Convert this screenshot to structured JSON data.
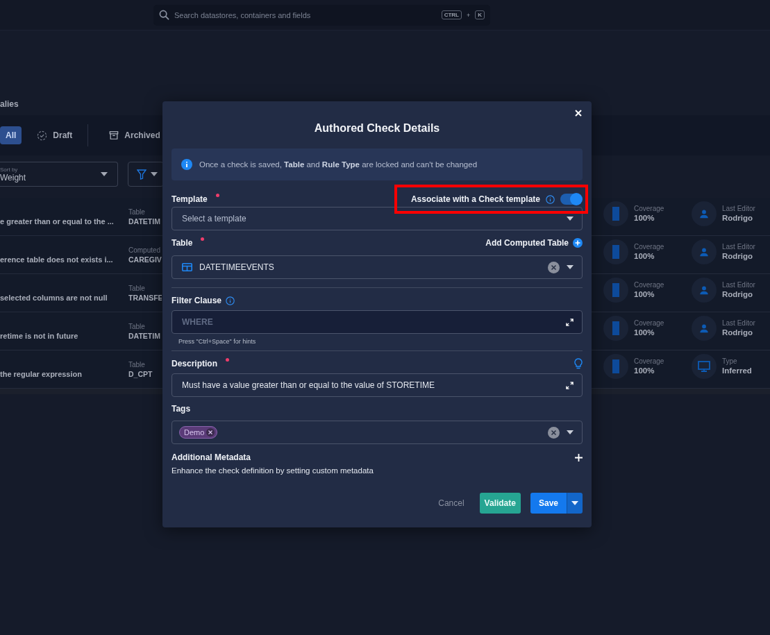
{
  "search": {
    "placeholder": "Search datastores, containers and fields",
    "keys": [
      "CTRL",
      "+",
      "K"
    ]
  },
  "page_heading": "alies",
  "status_tabs": [
    {
      "label": "All",
      "selected": true,
      "kind": "plain"
    },
    {
      "label": "Draft",
      "selected": false,
      "kind": "draft"
    },
    {
      "label": "Archived",
      "selected": false,
      "kind": "archived"
    }
  ],
  "sort": {
    "label": "Sort by",
    "value": "Weight"
  },
  "rows": [
    {
      "description": "e greater than or equal to the ...",
      "table_label": "Table",
      "table": "DATETIM",
      "coverage_label": "Coverage",
      "coverage": "100%",
      "kind": "editor",
      "meta_label": "Last Editor",
      "meta_value": "Rodrigo"
    },
    {
      "description": "erence table does not exists i...",
      "table_label": "Computed",
      "table": "CAREGIV",
      "coverage_label": "Coverage",
      "coverage": "100%",
      "kind": "editor",
      "meta_label": "Last Editor",
      "meta_value": "Rodrigo"
    },
    {
      "description": "selected columns are not null",
      "table_label": "Table",
      "table": "TRANSFE",
      "coverage_label": "Coverage",
      "coverage": "100%",
      "kind": "editor",
      "meta_label": "Last Editor",
      "meta_value": "Rodrigo"
    },
    {
      "description": "retime is not in future",
      "table_label": "Table",
      "table": "DATETIM",
      "coverage_label": "Coverage",
      "coverage": "100%",
      "kind": "editor",
      "meta_label": "Last Editor",
      "meta_value": "Rodrigo"
    },
    {
      "description": "the regular expression",
      "table_label": "Table",
      "table": "D_CPT",
      "coverage_label": "Coverage",
      "coverage": "100%",
      "kind": "type",
      "meta_label": "Type",
      "meta_value": "Inferred"
    }
  ],
  "dialog": {
    "title": "Authored Check Details",
    "notice": "Once a check is saved, **Table** and **Rule Type** are locked and can't be changed",
    "template": {
      "label": "Template",
      "required": true,
      "placeholder": "Select a template"
    },
    "associate_template": {
      "label": "Associate with a Check template",
      "on": true,
      "highlighted": true
    },
    "table": {
      "label": "Table",
      "required": true,
      "value": "DATETIMEEVENTS",
      "add_label": "Add Computed Table"
    },
    "filter": {
      "label": "Filter Clause",
      "placeholder": "WHERE",
      "hint": "Press \"Ctrl+Space\" for hints"
    },
    "description": {
      "label": "Description",
      "required": true,
      "value": "Must have a value greater than or equal to the value of STORETIME"
    },
    "tags": {
      "label": "Tags",
      "items": [
        "Demo"
      ]
    },
    "metadata": {
      "label": "Additional Metadata",
      "text": "Enhance the check definition by setting custom metadata"
    },
    "buttons": {
      "cancel": "Cancel",
      "validate": "Validate",
      "save": "Save"
    }
  }
}
